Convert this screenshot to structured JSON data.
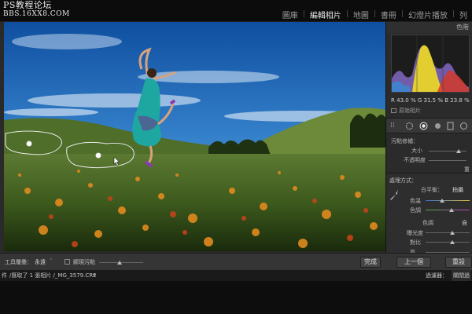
{
  "watermark": {
    "line1": "PS教程论坛",
    "line2": "BBS.16XX8.COM"
  },
  "modules": [
    {
      "label": "圖庫",
      "active": false
    },
    {
      "label": "編輯相片",
      "active": true
    },
    {
      "label": "地圖",
      "active": false
    },
    {
      "label": "書冊",
      "active": false
    },
    {
      "label": "幻燈片播放",
      "active": false
    },
    {
      "label": "列",
      "active": false
    }
  ],
  "right_panel": {
    "histogram_header": "色階",
    "rgb": {
      "r_label": "R",
      "r_value": "43.0",
      "g_label": "G",
      "g_value": "31.5",
      "b_label": "B",
      "b_value": "23.8",
      "unit": "%"
    },
    "original_photo_label": "原始相片",
    "brush": {
      "title": "污點修補：",
      "size_label": "大小",
      "opacity_label": "不透明度",
      "reset_label": "重"
    },
    "adjust": {
      "title": "處理方式：",
      "wb_label": "白平衡：",
      "wb_value": "拍攝",
      "temp_label": "色溫",
      "tint_label": "色調",
      "tone_label": "色調",
      "tone_value": "自",
      "exposure_label": "曝光度",
      "contrast_label": "對比",
      "more_label": "亮"
    },
    "prev_button": "上一個",
    "reset_button": "重設"
  },
  "bottom_toolbar": {
    "tool_overlay_label": "工具覆疊：",
    "tool_overlay_value": "永遠",
    "show_spots_label": "顯現污點",
    "done_button": "完成"
  },
  "status_bar": {
    "path_prefix": "件",
    "path_text": "/匯取了 1 張相片 /_MG_3579.CR2",
    "filter_label": "過濾器：",
    "filter_value": "關閉過"
  }
}
